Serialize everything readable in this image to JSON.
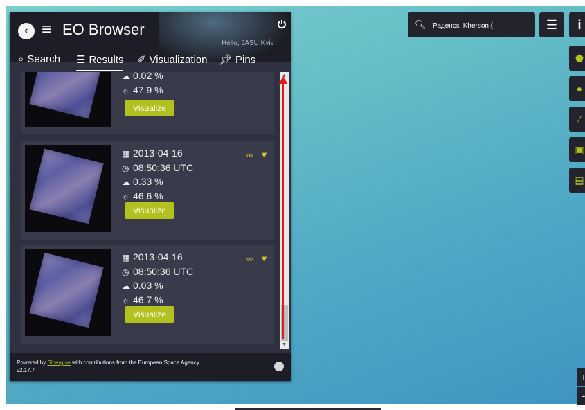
{
  "app": {
    "title": "EO Browser",
    "greeting": "Hello, JASU Kyiv",
    "back_icon": "chevron-left-icon",
    "power_icon": "power-icon"
  },
  "tabs": [
    {
      "label": "Search",
      "icon": "search-icon"
    },
    {
      "label": "Results",
      "icon": "list-icon",
      "active": true
    },
    {
      "label": "Visualization",
      "icon": "brush-icon"
    },
    {
      "label": "Pins",
      "icon": "pin-icon"
    }
  ],
  "results": [
    {
      "date": "",
      "time": "",
      "cloud": "0.02 %",
      "sun": "47.9 %",
      "visualize": "Visualize"
    },
    {
      "date": "2013-04-16",
      "time": "08:50:36 UTC",
      "cloud": "0.33 %",
      "sun": "46.6 %",
      "visualize": "Visualize"
    },
    {
      "date": "2013-04-16",
      "time": "08:50:36 UTC",
      "cloud": "0.03 %",
      "sun": "46.7 %",
      "visualize": "Visualize"
    }
  ],
  "footer": {
    "powered_by": "Powered by",
    "sinergise": "Sinergise",
    "contribution": "with contributions from the European Space Agency",
    "version": "v2.17.7"
  },
  "map": {
    "search_value": "Раденск, Kherson (",
    "layers_icon": "layers-icon",
    "info_icon": "info-icon",
    "tools": [
      "pentagon-icon",
      "location-pin-icon",
      "ruler-icon",
      "image-export-icon",
      "film-icon"
    ],
    "zoom_in": "+",
    "zoom_out": "-"
  },
  "colors": {
    "panel_bg": "#2f3040",
    "header_bg": "#1c1d26",
    "accent": "#b2c11d",
    "annotation_arrow": "#e31a1a"
  }
}
